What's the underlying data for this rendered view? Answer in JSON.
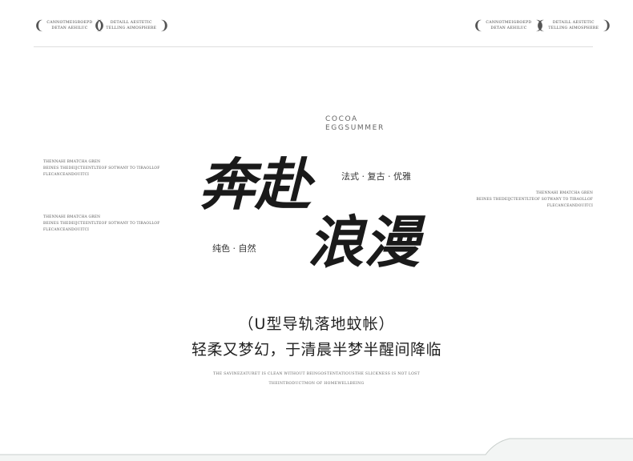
{
  "badges": [
    {
      "line1": "CANNOTMEIGROEPD",
      "line2": "DETAN AEHILUC"
    },
    {
      "line1": "DETAILL AESTETIC",
      "line2": "TELLING AIMOSPHERE"
    },
    {
      "line1": "CANNOTMEIGROEPD",
      "line2": "DETAN AEHILUC"
    },
    {
      "line1": "DETAILL AESTETIC",
      "line2": "TELLING AIMOSPHERE"
    }
  ],
  "brand": {
    "line1": "COCOA",
    "line2": "EGGSUMMER"
  },
  "headline": {
    "part1": "奔赴",
    "part2": "浪漫"
  },
  "tags": {
    "style": "法式 · 复古 · 优雅",
    "color": "纯色 · 自然"
  },
  "left_blocks": [
    {
      "l1": "THENNAHI BMATCHA GREN",
      "l2": "BEINES THEDEIJCTEENTLTEOF SOTWANY TO TIRAOLLOF",
      "l3": "FLECANCEANDOUITCI"
    },
    {
      "l1": "THENNAHI BMATCHA GREN",
      "l2": "BEINES THEDEIJCTEENTLTEOF SOTWANY TO TIRAOLLOF",
      "l3": "FLECANCEANDOUITCI"
    }
  ],
  "right_block": {
    "l1": "THENNAHI BMATCHA GREN",
    "l2": "BEINES THEDEIJCTEENTLTEOF SOTWANY TO TIRAOLLOF",
    "l3": "FLECANCEANDOUITCI"
  },
  "product": "（U型导轨落地蚊帐）",
  "tagline": "轻柔又梦幻，于清晨半梦半醒间降临",
  "description": {
    "line1": "THE SAVINEZATURET IS CLEAN WITHOUT BEINGOSTENTATIOUSTHE SLICKNESS IS NOT LOST",
    "line2": "THEINTRODUCTMON OF HOMEWELLBEING"
  }
}
